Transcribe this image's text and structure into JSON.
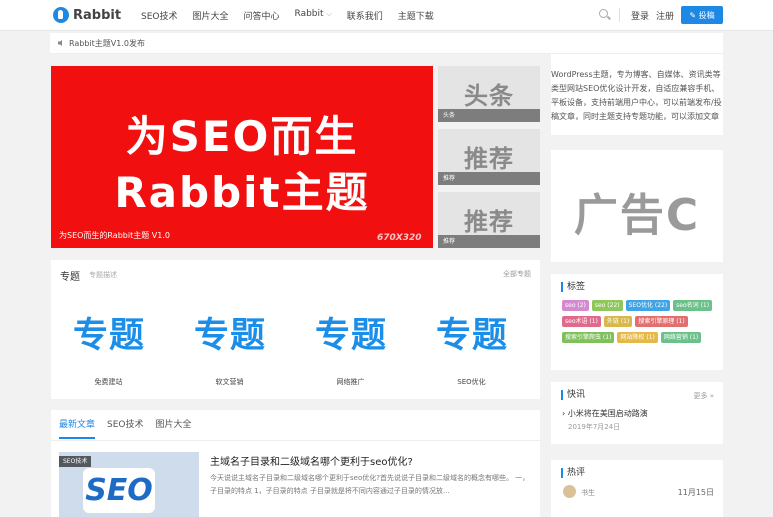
{
  "header": {
    "logo_text": "Rabbit",
    "nav": [
      "SEO技术",
      "图片大全",
      "问答中心",
      "Rabbit",
      "联系我们",
      "主题下载"
    ],
    "login": "登录",
    "register": "注册",
    "submit": "✎ 投稿"
  },
  "notice": {
    "text": "Rabbit主题V1.0发布"
  },
  "slider": {
    "line1": "为SEO而生",
    "line2": "Rabbit主题",
    "caption": "为SEO而生的Rabbit主题 V1.0",
    "size": "670X320"
  },
  "thumbs": [
    {
      "big": "头条",
      "label": "头条"
    },
    {
      "big": "推荐",
      "label": "推荐"
    },
    {
      "big": "推荐",
      "label": "推荐"
    }
  ],
  "intro": {
    "lines": [
      "WordPress主题，专为博客、自媒体、资讯类等",
      "类型网站SEO优化设计开发，自适应兼容手机、",
      "平板设备，支持前端用户中心，可以前端发布/投",
      "稿文章，同时主题支持专题功能，可以添加文章"
    ]
  },
  "ad": {
    "text": "广告C"
  },
  "tags_panel": {
    "title": "标签",
    "tags": [
      {
        "label": "seo (2)",
        "color": "#d58ad0"
      },
      {
        "label": "seo (22)",
        "color": "#8fc75a"
      },
      {
        "label": "SEO优化 (22)",
        "color": "#3fa3e6"
      },
      {
        "label": "seo名词 (1)",
        "color": "#6cc08a"
      },
      {
        "label": "seo术语 (1)",
        "color": "#e06a8e"
      },
      {
        "label": "外链 (1)",
        "color": "#d8b84a"
      },
      {
        "label": "搜索引擎原理 (1)",
        "color": "#e07070"
      },
      {
        "label": "搜索引擎爬虫 (1)",
        "color": "#7fc05a"
      },
      {
        "label": "网站降权 (1)",
        "color": "#e6b84a"
      },
      {
        "label": "网络营销 (1)",
        "color": "#6cc08a"
      }
    ]
  },
  "news_panel": {
    "title": "快讯",
    "more": "更多 »",
    "item": "小米将在美国启动路演",
    "date": "2019年7月24日"
  },
  "hot_panel": {
    "title": "热评",
    "name": "书生",
    "date": "11月15日"
  },
  "topics": {
    "title": "专题",
    "sub": "专题描述",
    "all": "全部专题",
    "img_text": "专题",
    "items": [
      "免费建站",
      "软文营销",
      "网络推广",
      "SEO优化"
    ]
  },
  "articles": {
    "tabs": [
      "最新文章",
      "SEO技术",
      "图片大全"
    ],
    "badge": "SEO技术",
    "img_text": "SEO",
    "title": "主域名子目录和二级域名哪个更利于seo优化?",
    "desc": "今天说说主域名子目录和二级域名哪个更利于seo优化?首先说说子目录和二级域名的概念有哪些。 一，子目录的特点 1，子目录的特点 子目录就是将不同内容通过子目录的情况放..."
  }
}
